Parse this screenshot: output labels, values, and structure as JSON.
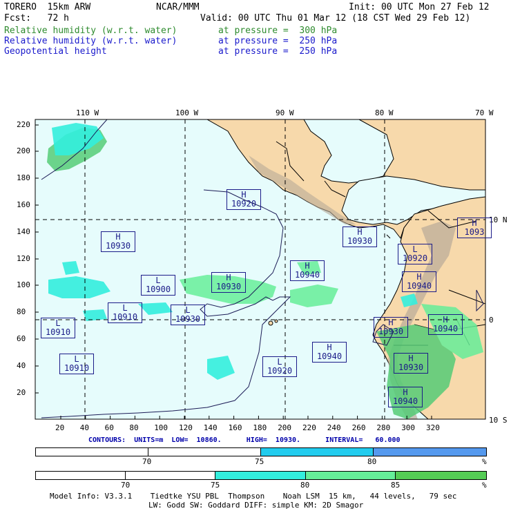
{
  "header": {
    "line1_left": "TORERO  15km ARW",
    "line1_mid": "NCAR/MMM",
    "line1_right": "Init: 00 UTC Mon 27 Feb 12",
    "line2_left": "Fcst:   72 h",
    "line2_right": "Valid: 00 UTC Thu 01 Mar 12 (18 CST Wed 29 Feb 12)",
    "fields": [
      {
        "name": "Relative humidity (w.r.t. water)",
        "level": "at pressure =  300 hPa",
        "color": "#2e8b2e"
      },
      {
        "name": "Relative humidity (w.r.t. water)",
        "level": "at pressure =  250 hPa",
        "color": "#1a1acc"
      },
      {
        "name": "Geopotential height",
        "level": "at pressure =  250 hPa",
        "color": "#1a1acc"
      }
    ]
  },
  "map": {
    "lon_labels": [
      "110 W",
      "100 W",
      "90 W",
      "80 W",
      "70 W"
    ],
    "lat_labels": [
      "10 N",
      "0",
      "10 S"
    ],
    "y_ticks": [
      "220",
      "200",
      "180",
      "160",
      "140",
      "120",
      "100",
      "80",
      "60",
      "40",
      "20"
    ],
    "x_ticks": [
      "20",
      "40",
      "60",
      "80",
      "100",
      "120",
      "140",
      "160",
      "180",
      "200",
      "220",
      "240",
      "260",
      "280",
      "300",
      "320"
    ],
    "ocean_color": "#e6fcfc",
    "land_color": "#f7d9ab",
    "markers": [
      {
        "type": "H",
        "value": "10920"
      },
      {
        "type": "H",
        "value": "10930"
      },
      {
        "type": "H",
        "value": "10930"
      },
      {
        "type": "L",
        "value": "10900"
      },
      {
        "type": "H",
        "value": "10930"
      },
      {
        "type": "H",
        "value": "10940"
      },
      {
        "type": "H",
        "value": "10940"
      },
      {
        "type": "L",
        "value": "10910"
      },
      {
        "type": "L",
        "value": "10910"
      },
      {
        "type": "L",
        "value": "10930"
      },
      {
        "type": "H",
        "value": "10940"
      },
      {
        "type": "L",
        "value": "10920"
      },
      {
        "type": "H",
        "value": "10930"
      },
      {
        "type": "H",
        "value": "10940"
      },
      {
        "type": "L",
        "value": "10910"
      },
      {
        "type": "L",
        "value": "10920"
      },
      {
        "type": "H",
        "value": "10930"
      },
      {
        "type": "H",
        "value": "10940"
      },
      {
        "type": "H",
        "value": "1093"
      }
    ]
  },
  "contours": {
    "label": "CONTOURS:  UNITS=m  LOW=  10860.      HIGH=  10930.      INTERVAL=   60.000"
  },
  "legend1": {
    "ticks": [
      "70",
      "75",
      "80"
    ],
    "unit": "%",
    "colors": [
      "#ffffff",
      "#ffffff",
      "#22ccee",
      "#5599ee"
    ]
  },
  "legend2": {
    "ticks": [
      "70",
      "75",
      "80",
      "85"
    ],
    "unit": "%",
    "colors": [
      "#ffffff",
      "#ffffff",
      "#33eedd",
      "#66ee99",
      "#55cc55"
    ]
  },
  "footer": {
    "line1": "Model Info: V3.3.1    Tiedtke YSU PBL  Thompson    Noah LSM  15 km,   44 levels,   79 sec",
    "line2": "LW: Godd SW: Goddard DIFF: simple KM: 2D Smagor"
  }
}
